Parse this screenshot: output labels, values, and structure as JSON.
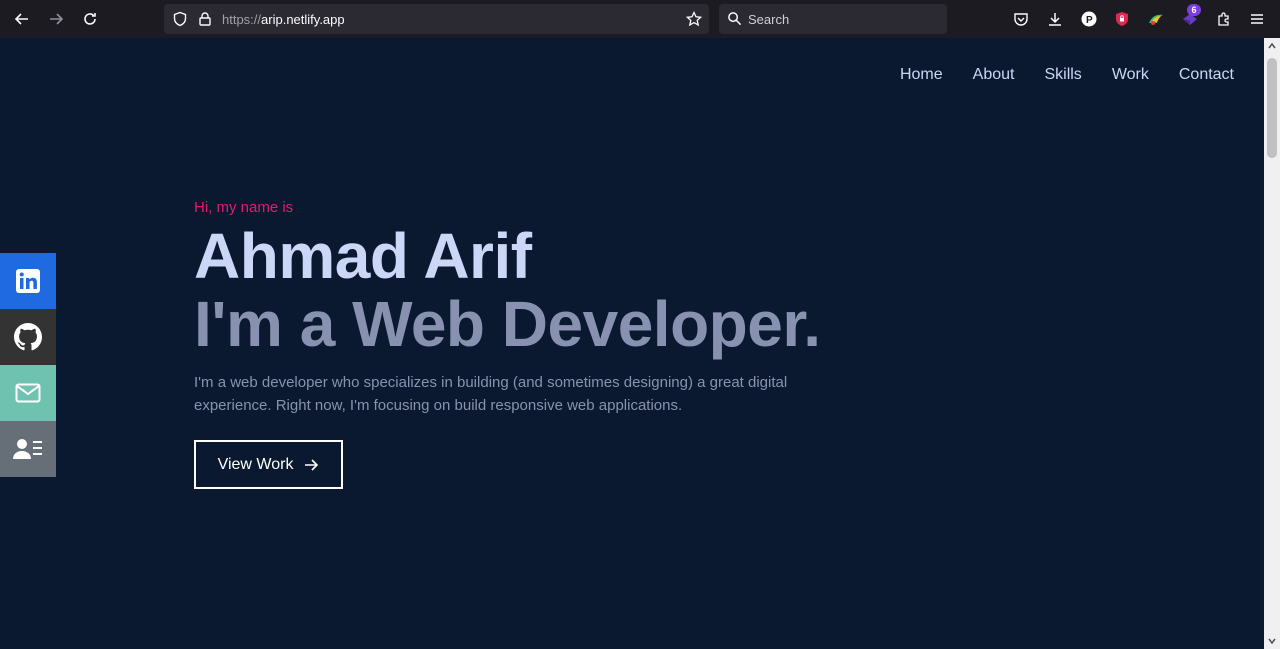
{
  "browser": {
    "url_scheme": "https://",
    "url_host": "arip.netlify.app",
    "search_placeholder": "Search",
    "extension_badge": "6"
  },
  "nav": {
    "items": [
      "Home",
      "About",
      "Skills",
      "Work",
      "Contact"
    ]
  },
  "hero": {
    "greeting": "Hi, my name is",
    "name": "Ahmad Arif",
    "role": "I'm a Web Developer.",
    "description": "I'm a web developer who specializes in building (and sometimes designing) a great digital experience. Right now, I'm focusing on build responsive web applications.",
    "cta_label": "View Work"
  },
  "social": [
    {
      "icon": "linkedin-icon",
      "color": "#1f6ae0"
    },
    {
      "icon": "github-icon",
      "color": "#333333"
    },
    {
      "icon": "mail-icon",
      "color": "#6fc2b0"
    },
    {
      "icon": "contact-card-icon",
      "color": "#666e77"
    }
  ],
  "colors": {
    "background": "#0a192f",
    "accent": "#e31b6d",
    "heading": "#ccd6f6",
    "subtext": "#8892b0"
  }
}
